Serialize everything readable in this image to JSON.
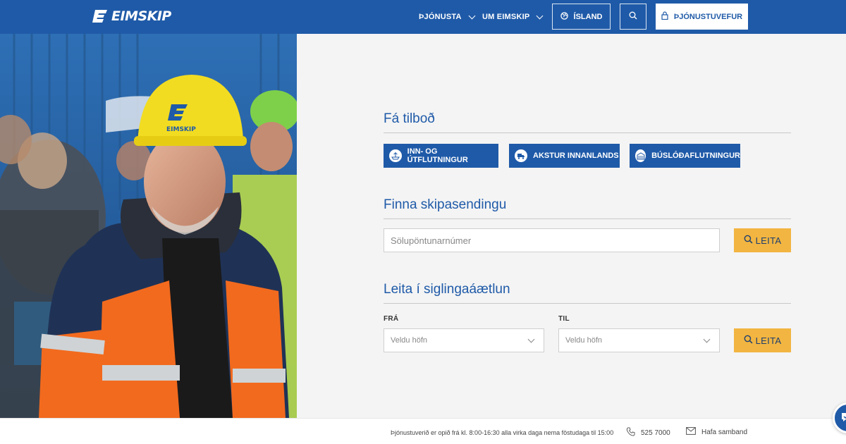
{
  "header": {
    "logo_text": "EIMSKIP",
    "nav": [
      {
        "label": "ÞJÓNUSTA"
      },
      {
        "label": "UM EIMSKIP"
      }
    ],
    "language_label": "ÍSLAND",
    "service_web_label": "ÞJÓNUSTUVEFUR"
  },
  "hero": {
    "helmet_text": "EIMSKIP"
  },
  "offer": {
    "title": "Fá tilboð",
    "buttons": [
      {
        "label": "INN- OG ÚTFLUTNINGUR",
        "icon": "ship-icon"
      },
      {
        "label": "AKSTUR INNANLANDS",
        "icon": "truck-icon"
      },
      {
        "label": "BÚSLÓÐAFLUTNINGUR",
        "icon": "container-icon"
      }
    ]
  },
  "tracking": {
    "title": "Finna skipasendingu",
    "input_placeholder": "Sölupöntunarnúmer",
    "search_label": "LEITA"
  },
  "schedule": {
    "title": "Leita í siglingaáætlun",
    "from_label": "FRÁ",
    "to_label": "TIL",
    "from_placeholder": "Veldu höfn",
    "to_placeholder": "Veldu höfn",
    "search_label": "LEITA"
  },
  "footer": {
    "hours_text": "Þjónustuverið er opið frá kl. 8:00-16:30 alla virka daga nema föstudaga til 15:00",
    "phone": "525 7000",
    "contact_label": "Hafa samband"
  },
  "colors": {
    "brand_blue": "#1f5aa8",
    "accent_yellow": "#f2b541",
    "background": "#f4f4f4"
  }
}
